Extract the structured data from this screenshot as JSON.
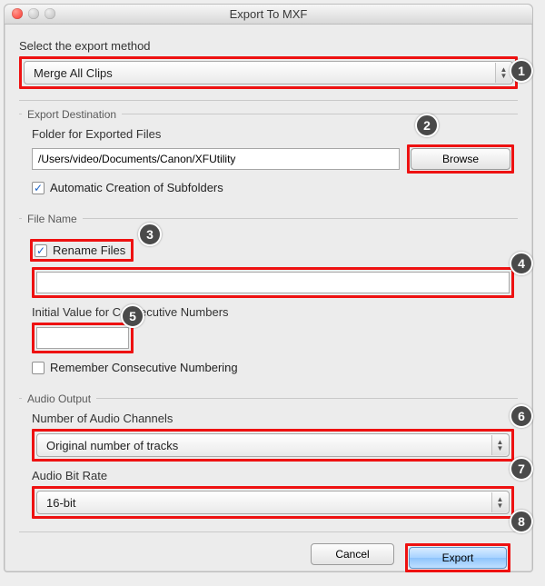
{
  "window": {
    "title": "Export To MXF"
  },
  "main": {
    "select_method_label": "Select the export method",
    "method_value": "Merge All Clips"
  },
  "export_destination": {
    "title": "Export Destination",
    "folder_label": "Folder for Exported Files",
    "folder_value": "/Users/video/Documents/Canon/XFUtility",
    "browse_label": "Browse",
    "auto_subfolders_label": "Automatic Creation of Subfolders",
    "auto_subfolders_checked": true
  },
  "file_name": {
    "title": "File Name",
    "rename_label": "Rename Files",
    "rename_checked": true,
    "name_value": "",
    "initial_label": "Initial Value for Consecutive Numbers",
    "initial_value": "",
    "remember_label": "Remember Consecutive Numbering",
    "remember_checked": false
  },
  "audio": {
    "title": "Audio Output",
    "channels_label": "Number of Audio Channels",
    "channels_value": "Original number of tracks",
    "bitrate_label": "Audio Bit Rate",
    "bitrate_value": "16-bit"
  },
  "buttons": {
    "cancel": "Cancel",
    "export": "Export"
  },
  "callouts": [
    "1",
    "2",
    "3",
    "4",
    "5",
    "6",
    "7",
    "8"
  ]
}
